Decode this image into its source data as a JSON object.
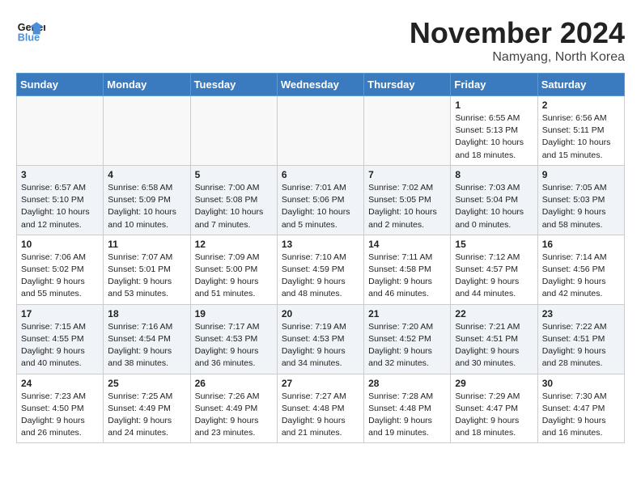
{
  "logo": {
    "line1": "General",
    "line2": "Blue"
  },
  "title": "November 2024",
  "location": "Namyang, North Korea",
  "days_header": [
    "Sunday",
    "Monday",
    "Tuesday",
    "Wednesday",
    "Thursday",
    "Friday",
    "Saturday"
  ],
  "weeks": [
    [
      {
        "day": "",
        "info": ""
      },
      {
        "day": "",
        "info": ""
      },
      {
        "day": "",
        "info": ""
      },
      {
        "day": "",
        "info": ""
      },
      {
        "day": "",
        "info": ""
      },
      {
        "day": "1",
        "info": "Sunrise: 6:55 AM\nSunset: 5:13 PM\nDaylight: 10 hours and 18 minutes."
      },
      {
        "day": "2",
        "info": "Sunrise: 6:56 AM\nSunset: 5:11 PM\nDaylight: 10 hours and 15 minutes."
      }
    ],
    [
      {
        "day": "3",
        "info": "Sunrise: 6:57 AM\nSunset: 5:10 PM\nDaylight: 10 hours and 12 minutes."
      },
      {
        "day": "4",
        "info": "Sunrise: 6:58 AM\nSunset: 5:09 PM\nDaylight: 10 hours and 10 minutes."
      },
      {
        "day": "5",
        "info": "Sunrise: 7:00 AM\nSunset: 5:08 PM\nDaylight: 10 hours and 7 minutes."
      },
      {
        "day": "6",
        "info": "Sunrise: 7:01 AM\nSunset: 5:06 PM\nDaylight: 10 hours and 5 minutes."
      },
      {
        "day": "7",
        "info": "Sunrise: 7:02 AM\nSunset: 5:05 PM\nDaylight: 10 hours and 2 minutes."
      },
      {
        "day": "8",
        "info": "Sunrise: 7:03 AM\nSunset: 5:04 PM\nDaylight: 10 hours and 0 minutes."
      },
      {
        "day": "9",
        "info": "Sunrise: 7:05 AM\nSunset: 5:03 PM\nDaylight: 9 hours and 58 minutes."
      }
    ],
    [
      {
        "day": "10",
        "info": "Sunrise: 7:06 AM\nSunset: 5:02 PM\nDaylight: 9 hours and 55 minutes."
      },
      {
        "day": "11",
        "info": "Sunrise: 7:07 AM\nSunset: 5:01 PM\nDaylight: 9 hours and 53 minutes."
      },
      {
        "day": "12",
        "info": "Sunrise: 7:09 AM\nSunset: 5:00 PM\nDaylight: 9 hours and 51 minutes."
      },
      {
        "day": "13",
        "info": "Sunrise: 7:10 AM\nSunset: 4:59 PM\nDaylight: 9 hours and 48 minutes."
      },
      {
        "day": "14",
        "info": "Sunrise: 7:11 AM\nSunset: 4:58 PM\nDaylight: 9 hours and 46 minutes."
      },
      {
        "day": "15",
        "info": "Sunrise: 7:12 AM\nSunset: 4:57 PM\nDaylight: 9 hours and 44 minutes."
      },
      {
        "day": "16",
        "info": "Sunrise: 7:14 AM\nSunset: 4:56 PM\nDaylight: 9 hours and 42 minutes."
      }
    ],
    [
      {
        "day": "17",
        "info": "Sunrise: 7:15 AM\nSunset: 4:55 PM\nDaylight: 9 hours and 40 minutes."
      },
      {
        "day": "18",
        "info": "Sunrise: 7:16 AM\nSunset: 4:54 PM\nDaylight: 9 hours and 38 minutes."
      },
      {
        "day": "19",
        "info": "Sunrise: 7:17 AM\nSunset: 4:53 PM\nDaylight: 9 hours and 36 minutes."
      },
      {
        "day": "20",
        "info": "Sunrise: 7:19 AM\nSunset: 4:53 PM\nDaylight: 9 hours and 34 minutes."
      },
      {
        "day": "21",
        "info": "Sunrise: 7:20 AM\nSunset: 4:52 PM\nDaylight: 9 hours and 32 minutes."
      },
      {
        "day": "22",
        "info": "Sunrise: 7:21 AM\nSunset: 4:51 PM\nDaylight: 9 hours and 30 minutes."
      },
      {
        "day": "23",
        "info": "Sunrise: 7:22 AM\nSunset: 4:51 PM\nDaylight: 9 hours and 28 minutes."
      }
    ],
    [
      {
        "day": "24",
        "info": "Sunrise: 7:23 AM\nSunset: 4:50 PM\nDaylight: 9 hours and 26 minutes."
      },
      {
        "day": "25",
        "info": "Sunrise: 7:25 AM\nSunset: 4:49 PM\nDaylight: 9 hours and 24 minutes."
      },
      {
        "day": "26",
        "info": "Sunrise: 7:26 AM\nSunset: 4:49 PM\nDaylight: 9 hours and 23 minutes."
      },
      {
        "day": "27",
        "info": "Sunrise: 7:27 AM\nSunset: 4:48 PM\nDaylight: 9 hours and 21 minutes."
      },
      {
        "day": "28",
        "info": "Sunrise: 7:28 AM\nSunset: 4:48 PM\nDaylight: 9 hours and 19 minutes."
      },
      {
        "day": "29",
        "info": "Sunrise: 7:29 AM\nSunset: 4:47 PM\nDaylight: 9 hours and 18 minutes."
      },
      {
        "day": "30",
        "info": "Sunrise: 7:30 AM\nSunset: 4:47 PM\nDaylight: 9 hours and 16 minutes."
      }
    ]
  ]
}
